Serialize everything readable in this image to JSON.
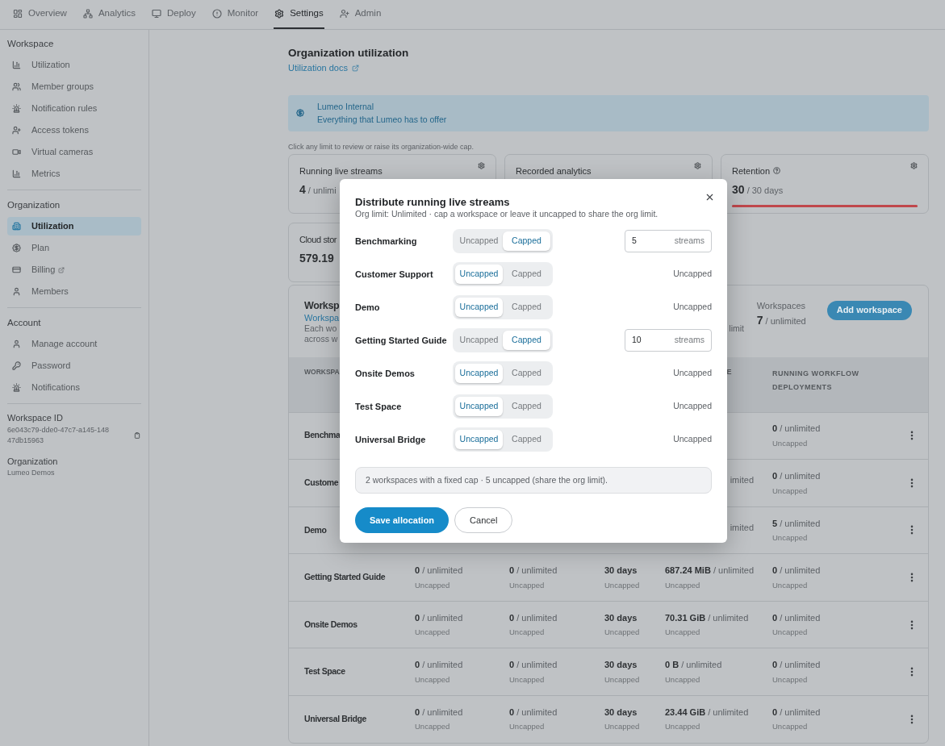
{
  "nav": {
    "tabs": [
      {
        "label": "Overview",
        "selected": false
      },
      {
        "label": "Analytics",
        "selected": false
      },
      {
        "label": "Deploy",
        "selected": false
      },
      {
        "label": "Monitor",
        "selected": false
      },
      {
        "label": "Settings",
        "selected": true
      },
      {
        "label": "Admin",
        "selected": false
      }
    ]
  },
  "sidebar": {
    "sections": [
      {
        "heading": "Workspace",
        "items": [
          {
            "label": "Utilization",
            "selected": false,
            "external": false
          },
          {
            "label": "Member groups",
            "selected": false,
            "external": false
          },
          {
            "label": "Notification rules",
            "selected": false,
            "external": false
          },
          {
            "label": "Access tokens",
            "selected": false,
            "external": false
          },
          {
            "label": "Virtual cameras",
            "selected": false,
            "external": false
          },
          {
            "label": "Metrics",
            "selected": false,
            "external": false
          }
        ]
      },
      {
        "heading": "Organization",
        "items": [
          {
            "label": "Utilization",
            "selected": true,
            "external": false
          },
          {
            "label": "Plan",
            "selected": false,
            "external": false
          },
          {
            "label": "Billing",
            "selected": false,
            "external": true
          },
          {
            "label": "Members",
            "selected": false,
            "external": false
          }
        ]
      },
      {
        "heading": "Account",
        "items": [
          {
            "label": "Manage account",
            "selected": false,
            "external": false
          },
          {
            "label": "Password",
            "selected": false,
            "external": false
          },
          {
            "label": "Notifications",
            "selected": false,
            "external": false
          }
        ]
      }
    ],
    "workspace_id": {
      "label": "Workspace ID",
      "value": "6e043c79-dde0-47c7-a145-14847db15963"
    },
    "organization": {
      "label": "Organization",
      "value": "Lumeo Demos"
    }
  },
  "page": {
    "title": "Organization utilization",
    "docs_link": "Utilization docs",
    "plan_banner": {
      "name": "Lumeo Internal",
      "description": "Everything that Lumeo has to offer"
    },
    "hint": "Click any limit to review or raise its organization-wide cap.",
    "limit_cards": [
      {
        "title": "Running live streams",
        "help": false,
        "value": "4",
        "limit": "/ unlimi"
      },
      {
        "title": "Recorded analytics",
        "help": false
      },
      {
        "title": "Retention",
        "help": true,
        "value": "30",
        "limit": "/ 30 days",
        "level": 1
      }
    ],
    "storage_card": {
      "title": "Cloud stor",
      "value": "579.19"
    },
    "workspaces": {
      "title": "Worksp",
      "link": "Workspa",
      "description_lines": [
        "Each wo",
        "across w"
      ],
      "description_tail": "limit",
      "count_label": "Workspaces",
      "count": "7",
      "count_limit": "/ unlimited",
      "add_button": "Add workspace",
      "table": {
        "header": {
          "column_1": "WORKSPA",
          "column_5": "E",
          "column_6": "RUNNING WORKFLOW DEPLOYMENTS"
        },
        "rows": [
          {
            "name": "Benchma",
            "cells": [
              null,
              null,
              null,
              null,
              {
                "value": "0",
                "limit": "/ unlimited",
                "note": "Uncapped"
              }
            ]
          },
          {
            "name": "Custome",
            "cells": [
              null,
              null,
              null,
              {
                "limit": "imited",
                "clipped": true
              },
              {
                "value": "0",
                "limit": "/ unlimited",
                "note": "Uncapped"
              }
            ]
          },
          {
            "name": "Demo",
            "cells": [
              null,
              null,
              null,
              {
                "limit": "imited",
                "clipped": true
              },
              {
                "value": "5",
                "limit": "/ unlimited",
                "note": "Uncapped"
              }
            ]
          },
          {
            "name": "Getting Started Guide",
            "cells": [
              {
                "value": "0",
                "limit": "/ unlimited",
                "note": "Uncapped"
              },
              {
                "value": "0",
                "limit": "/ unlimited",
                "note": "Uncapped"
              },
              {
                "value": "30 days",
                "note": "Uncapped"
              },
              {
                "value": "687.24 MiB",
                "limit": "/ unlimited",
                "note": "Uncapped"
              },
              {
                "value": "0",
                "limit": "/ unlimited",
                "note": "Uncapped"
              }
            ]
          },
          {
            "name": "Onsite Demos",
            "cells": [
              {
                "value": "0",
                "limit": "/ unlimited",
                "note": "Uncapped"
              },
              {
                "value": "0",
                "limit": "/ unlimited",
                "note": "Uncapped"
              },
              {
                "value": "30 days",
                "note": "Uncapped"
              },
              {
                "value": "70.31 GiB",
                "limit": "/ unlimited",
                "note": "Uncapped"
              },
              {
                "value": "0",
                "limit": "/ unlimited",
                "note": "Uncapped"
              }
            ]
          },
          {
            "name": "Test Space",
            "cells": [
              {
                "value": "0",
                "limit": "/ unlimited",
                "note": "Uncapped"
              },
              {
                "value": "0",
                "limit": "/ unlimited",
                "note": "Uncapped"
              },
              {
                "value": "30 days",
                "note": "Uncapped"
              },
              {
                "value": "0 B",
                "limit": "/ unlimited",
                "note": "Uncapped"
              },
              {
                "value": "0",
                "limit": "/ unlimited",
                "note": "Uncapped"
              }
            ]
          },
          {
            "name": "Universal Bridge",
            "cells": [
              {
                "value": "0",
                "limit": "/ unlimited",
                "note": "Uncapped"
              },
              {
                "value": "0",
                "limit": "/ unlimited",
                "note": "Uncapped"
              },
              {
                "value": "30 days",
                "note": "Uncapped"
              },
              {
                "value": "23.44 GiB",
                "limit": "/ unlimited",
                "note": "Uncapped"
              },
              {
                "value": "0",
                "limit": "/ unlimited",
                "note": "Uncapped"
              }
            ]
          }
        ]
      }
    }
  },
  "dialog": {
    "title": "Distribute running live streams",
    "subtitle": "Org limit: Unlimited · cap a workspace or leave it uncapped to share the org limit.",
    "rows": [
      {
        "name": "Benchmarking",
        "kind": "capped",
        "options": [
          {
            "label": "Uncapped",
            "selected": false
          },
          {
            "label": "Capped",
            "selected": true
          }
        ],
        "cap": "5",
        "unit": "streams"
      },
      {
        "name": "Customer Support",
        "kind": "uncapped",
        "options": [
          {
            "label": "Uncapped",
            "selected": true
          },
          {
            "label": "Capped",
            "selected": false
          }
        ],
        "status": "Uncapped"
      },
      {
        "name": "Demo",
        "kind": "uncapped",
        "options": [
          {
            "label": "Uncapped",
            "selected": true
          },
          {
            "label": "Capped",
            "selected": false
          }
        ],
        "status": "Uncapped"
      },
      {
        "name": "Getting Started Guide",
        "kind": "capped",
        "options": [
          {
            "label": "Uncapped",
            "selected": false
          },
          {
            "label": "Capped",
            "selected": true
          }
        ],
        "cap": "10",
        "unit": "streams"
      },
      {
        "name": "Onsite Demos",
        "kind": "uncapped",
        "options": [
          {
            "label": "Uncapped",
            "selected": true
          },
          {
            "label": "Capped",
            "selected": false
          }
        ],
        "status": "Uncapped"
      },
      {
        "name": "Test Space",
        "kind": "uncapped",
        "options": [
          {
            "label": "Uncapped",
            "selected": true
          },
          {
            "label": "Capped",
            "selected": false
          }
        ],
        "status": "Uncapped"
      },
      {
        "name": "Universal Bridge",
        "kind": "uncapped",
        "options": [
          {
            "label": "Uncapped",
            "selected": true
          },
          {
            "label": "Capped",
            "selected": false
          }
        ],
        "status": "Uncapped"
      }
    ],
    "summary": "2 workspaces with a fixed cap · 5 uncapped (share the org limit).",
    "buttons": [
      {
        "label": "Save allocation",
        "kind": "primary"
      },
      {
        "label": "Cancel",
        "kind": "secondary"
      }
    ]
  }
}
